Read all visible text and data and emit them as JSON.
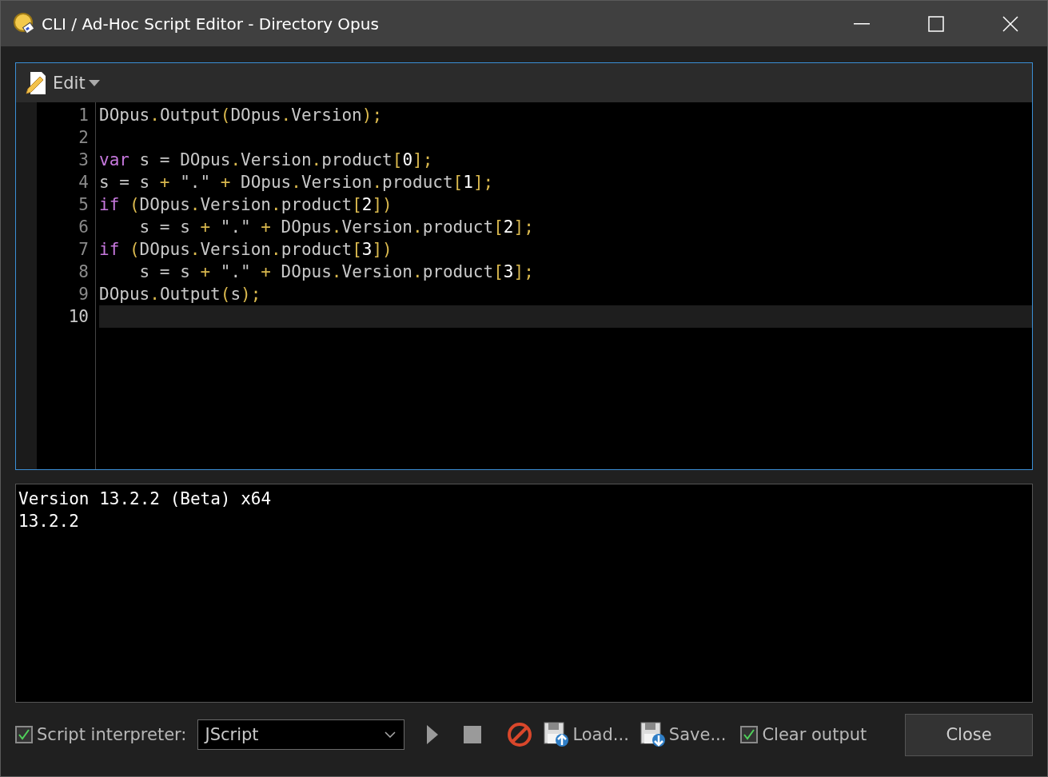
{
  "window": {
    "title": "CLI / Ad-Hoc Script Editor - Directory Opus"
  },
  "toolbar": {
    "menu_label": "Edit"
  },
  "editor": {
    "lines": [
      {
        "number": "1",
        "current": false,
        "tokens": [
          {
            "kind": "plain",
            "text": "DOpus"
          },
          {
            "kind": "op",
            "text": "."
          },
          {
            "kind": "plain",
            "text": "Output"
          },
          {
            "kind": "op",
            "text": "("
          },
          {
            "kind": "plain",
            "text": "DOpus"
          },
          {
            "kind": "op",
            "text": "."
          },
          {
            "kind": "plain",
            "text": "Version"
          },
          {
            "kind": "op",
            "text": ");"
          }
        ]
      },
      {
        "number": "2",
        "current": false
      },
      {
        "number": "3",
        "current": false,
        "tokens": [
          {
            "kind": "keyword",
            "text": "var"
          },
          {
            "kind": "plain",
            "text": " s = DOpus"
          },
          {
            "kind": "op",
            "text": "."
          },
          {
            "kind": "plain",
            "text": "Version"
          },
          {
            "kind": "op",
            "text": "."
          },
          {
            "kind": "plain",
            "text": "product"
          },
          {
            "kind": "op",
            "text": "["
          },
          {
            "kind": "number",
            "text": "0"
          },
          {
            "kind": "op",
            "text": "];"
          }
        ]
      },
      {
        "number": "4",
        "current": false,
        "tokens": [
          {
            "kind": "plain",
            "text": "s = s "
          },
          {
            "kind": "op",
            "text": "+"
          },
          {
            "kind": "plain",
            "text": " \".\" "
          },
          {
            "kind": "op",
            "text": "+"
          },
          {
            "kind": "plain",
            "text": " DOpus"
          },
          {
            "kind": "op",
            "text": "."
          },
          {
            "kind": "plain",
            "text": "Version"
          },
          {
            "kind": "op",
            "text": "."
          },
          {
            "kind": "plain",
            "text": "product"
          },
          {
            "kind": "op",
            "text": "["
          },
          {
            "kind": "number",
            "text": "1"
          },
          {
            "kind": "op",
            "text": "];"
          }
        ]
      },
      {
        "number": "5",
        "current": false,
        "tokens": [
          {
            "kind": "keyword",
            "text": "if"
          },
          {
            "kind": "op",
            "text": " ("
          },
          {
            "kind": "plain",
            "text": "DOpus"
          },
          {
            "kind": "op",
            "text": "."
          },
          {
            "kind": "plain",
            "text": "Version"
          },
          {
            "kind": "op",
            "text": "."
          },
          {
            "kind": "plain",
            "text": "product"
          },
          {
            "kind": "op",
            "text": "["
          },
          {
            "kind": "number",
            "text": "2"
          },
          {
            "kind": "op",
            "text": "])"
          }
        ]
      },
      {
        "number": "6",
        "current": false,
        "tokens": [
          {
            "kind": "plain",
            "text": "    s = s "
          },
          {
            "kind": "op",
            "text": "+"
          },
          {
            "kind": "plain",
            "text": " \".\" "
          },
          {
            "kind": "op",
            "text": "+"
          },
          {
            "kind": "plain",
            "text": " DOpus"
          },
          {
            "kind": "op",
            "text": "."
          },
          {
            "kind": "plain",
            "text": "Version"
          },
          {
            "kind": "op",
            "text": "."
          },
          {
            "kind": "plain",
            "text": "product"
          },
          {
            "kind": "op",
            "text": "["
          },
          {
            "kind": "number",
            "text": "2"
          },
          {
            "kind": "op",
            "text": "];"
          }
        ]
      },
      {
        "number": "7",
        "current": false,
        "tokens": [
          {
            "kind": "keyword",
            "text": "if"
          },
          {
            "kind": "op",
            "text": " ("
          },
          {
            "kind": "plain",
            "text": "DOpus"
          },
          {
            "kind": "op",
            "text": "."
          },
          {
            "kind": "plain",
            "text": "Version"
          },
          {
            "kind": "op",
            "text": "."
          },
          {
            "kind": "plain",
            "text": "product"
          },
          {
            "kind": "op",
            "text": "["
          },
          {
            "kind": "number",
            "text": "3"
          },
          {
            "kind": "op",
            "text": "])"
          }
        ]
      },
      {
        "number": "8",
        "current": false,
        "tokens": [
          {
            "kind": "plain",
            "text": "    s = s "
          },
          {
            "kind": "op",
            "text": "+"
          },
          {
            "kind": "plain",
            "text": " \".\" "
          },
          {
            "kind": "op",
            "text": "+"
          },
          {
            "kind": "plain",
            "text": " DOpus"
          },
          {
            "kind": "op",
            "text": "."
          },
          {
            "kind": "plain",
            "text": "Version"
          },
          {
            "kind": "op",
            "text": "."
          },
          {
            "kind": "plain",
            "text": "product"
          },
          {
            "kind": "op",
            "text": "["
          },
          {
            "kind": "number",
            "text": "3"
          },
          {
            "kind": "op",
            "text": "];"
          }
        ]
      },
      {
        "number": "9",
        "current": false,
        "tokens": [
          {
            "kind": "plain",
            "text": "DOpus"
          },
          {
            "kind": "op",
            "text": "."
          },
          {
            "kind": "plain",
            "text": "Output"
          },
          {
            "kind": "op",
            "text": "("
          },
          {
            "kind": "plain",
            "text": "s"
          },
          {
            "kind": "op",
            "text": ");"
          }
        ]
      },
      {
        "number": "10",
        "current": true
      }
    ]
  },
  "output": {
    "lines": [
      "Version 13.2.2 (Beta) x64",
      "13.2.2"
    ]
  },
  "bottom_bar": {
    "interpreter_checkbox": {
      "label": "Script interpreter:",
      "checked": true
    },
    "interpreter_select": {
      "value": "JScript"
    },
    "load_label": "Load...",
    "save_label": "Save...",
    "clear_checkbox": {
      "label": "Clear output",
      "checked": true
    },
    "close_label": "Close"
  }
}
